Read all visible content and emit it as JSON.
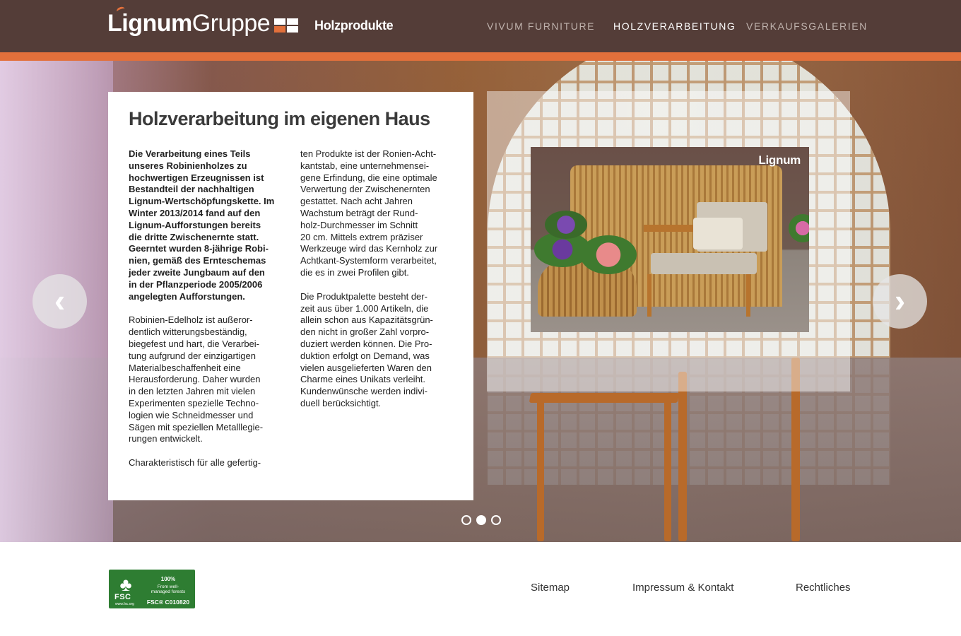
{
  "header": {
    "logo_bold": "Lignum",
    "logo_light": "Gruppe",
    "subtitle": "Holzprodukte",
    "nav": [
      {
        "label": "VIVUM FURNITURE",
        "active": false
      },
      {
        "label": "HOLZVERARBEITUNG",
        "active": true
      },
      {
        "label": "VERKAUFSGALERIEN",
        "active": false
      }
    ],
    "colors": {
      "accent": "#e2703b",
      "header_bg": "#3c221c"
    }
  },
  "slide": {
    "title": "Holzverarbeitung im eigenen Haus",
    "col1": {
      "intro_bold": [
        "Die Verarbeitung eines Teils",
        "unseres Robinienholzes zu",
        "hochwertigen Erzeugnissen ist",
        "Bestandteil der nachhaltigen",
        "Lignum-Wertschöpfungskette. Im",
        "Winter 2013/2014 fand auf den",
        "Lignum-Aufforstungen bereits",
        "die dritte Zwischenernte statt.",
        "Geerntet wurden 8-jährige Robi-",
        "nien, gemäß des Ernteschemas",
        "jeder zweite Jungbaum auf den",
        "in der Pflanzperiode 2005/2006",
        "angelegten Aufforstungen."
      ],
      "para2": [
        "Robinien-Edelholz ist außeror-",
        "dentlich witterungsbeständig,",
        "biegefest und hart, die Verarbei-",
        "tung aufgrund der einzigartigen",
        "Materialbeschaffenheit eine",
        "Herausforderung. Daher wurden",
        "in den letzten Jahren mit vielen",
        "Experimenten spezielle Techno-",
        "logien wie Schneidmesser und",
        "Sägen mit speziellen Metalllegie-",
        "rungen entwickelt."
      ],
      "para3": [
        "Charakteristisch für alle gefertig-"
      ]
    },
    "col2": {
      "para1": [
        "ten Produkte ist der Ronien-Acht-",
        "kantstab, eine unternehmensei-",
        "gene Erfindung, die eine optimale",
        "Verwertung der Zwischenernten",
        "gestattet. Nach acht Jahren",
        "Wachstum beträgt der Rund-",
        "holz-Durchmesser im Schnitt",
        "20 cm. Mittels extrem präziser",
        "Werkzeuge wird das Kernholz zur",
        "Achtkant-Systemform verarbeitet,",
        "die es in zwei Profilen gibt."
      ],
      "para2": [
        "Die Produktpalette besteht der-",
        "zeit aus über 1.000 Artikeln, die",
        "allein schon aus Kapazitätsgrün-",
        "den nicht in großer Zahl vorpro-",
        "duziert werden können. Die Pro-",
        "duktion erfolgt on Demand, was",
        "vielen ausgelieferten Waren den",
        "Charme eines Unikats verleiht.",
        "Kundenwünsche werden indivi-",
        "duell berücksichtigt."
      ]
    },
    "photo_logo": "Lignum",
    "prev_icon": "chevron-left-icon",
    "next_icon": "chevron-right-icon",
    "prev_glyph": "‹",
    "next_glyph": "›",
    "dots": {
      "count": 3,
      "active_index": 1
    }
  },
  "footer": {
    "fsc": {
      "label": "FSC",
      "site": "www.fsc.org",
      "line1": "100%",
      "line2": "From well-\nmanaged forests",
      "code": "FSC® C010820"
    },
    "links": [
      "Sitemap",
      "Impressum & Kontakt",
      "Rechtliches"
    ]
  }
}
